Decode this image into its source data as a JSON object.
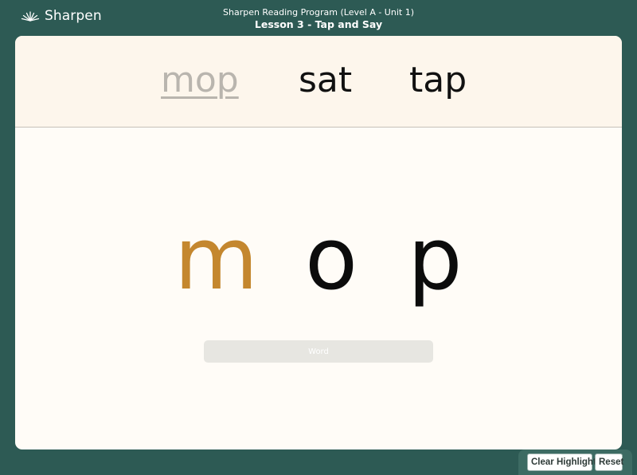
{
  "brand": {
    "name": "Sharpen",
    "logo_icon": "sunrise-icon"
  },
  "header": {
    "program": "Sharpen Reading Program (Level A - Unit 1)",
    "lesson": "Lesson 3 - Tap and Say"
  },
  "words": [
    {
      "text": "mop",
      "state": "selected"
    },
    {
      "text": "sat",
      "state": "default"
    },
    {
      "text": "tap",
      "state": "default"
    }
  ],
  "letters": [
    {
      "text": "m",
      "highlighted": true
    },
    {
      "text": "o",
      "highlighted": false
    },
    {
      "text": "p",
      "highlighted": false
    }
  ],
  "word_button_label": "Word",
  "controls": {
    "clear_highlight_label": "Clear Highlight",
    "reset_label": "Reset"
  },
  "colors": {
    "background": "#2d5a54",
    "card": "#fffcf7",
    "word_bar": "#fdf6ec",
    "highlight": "#c4872f",
    "selected_word": "#b9b5ae"
  }
}
